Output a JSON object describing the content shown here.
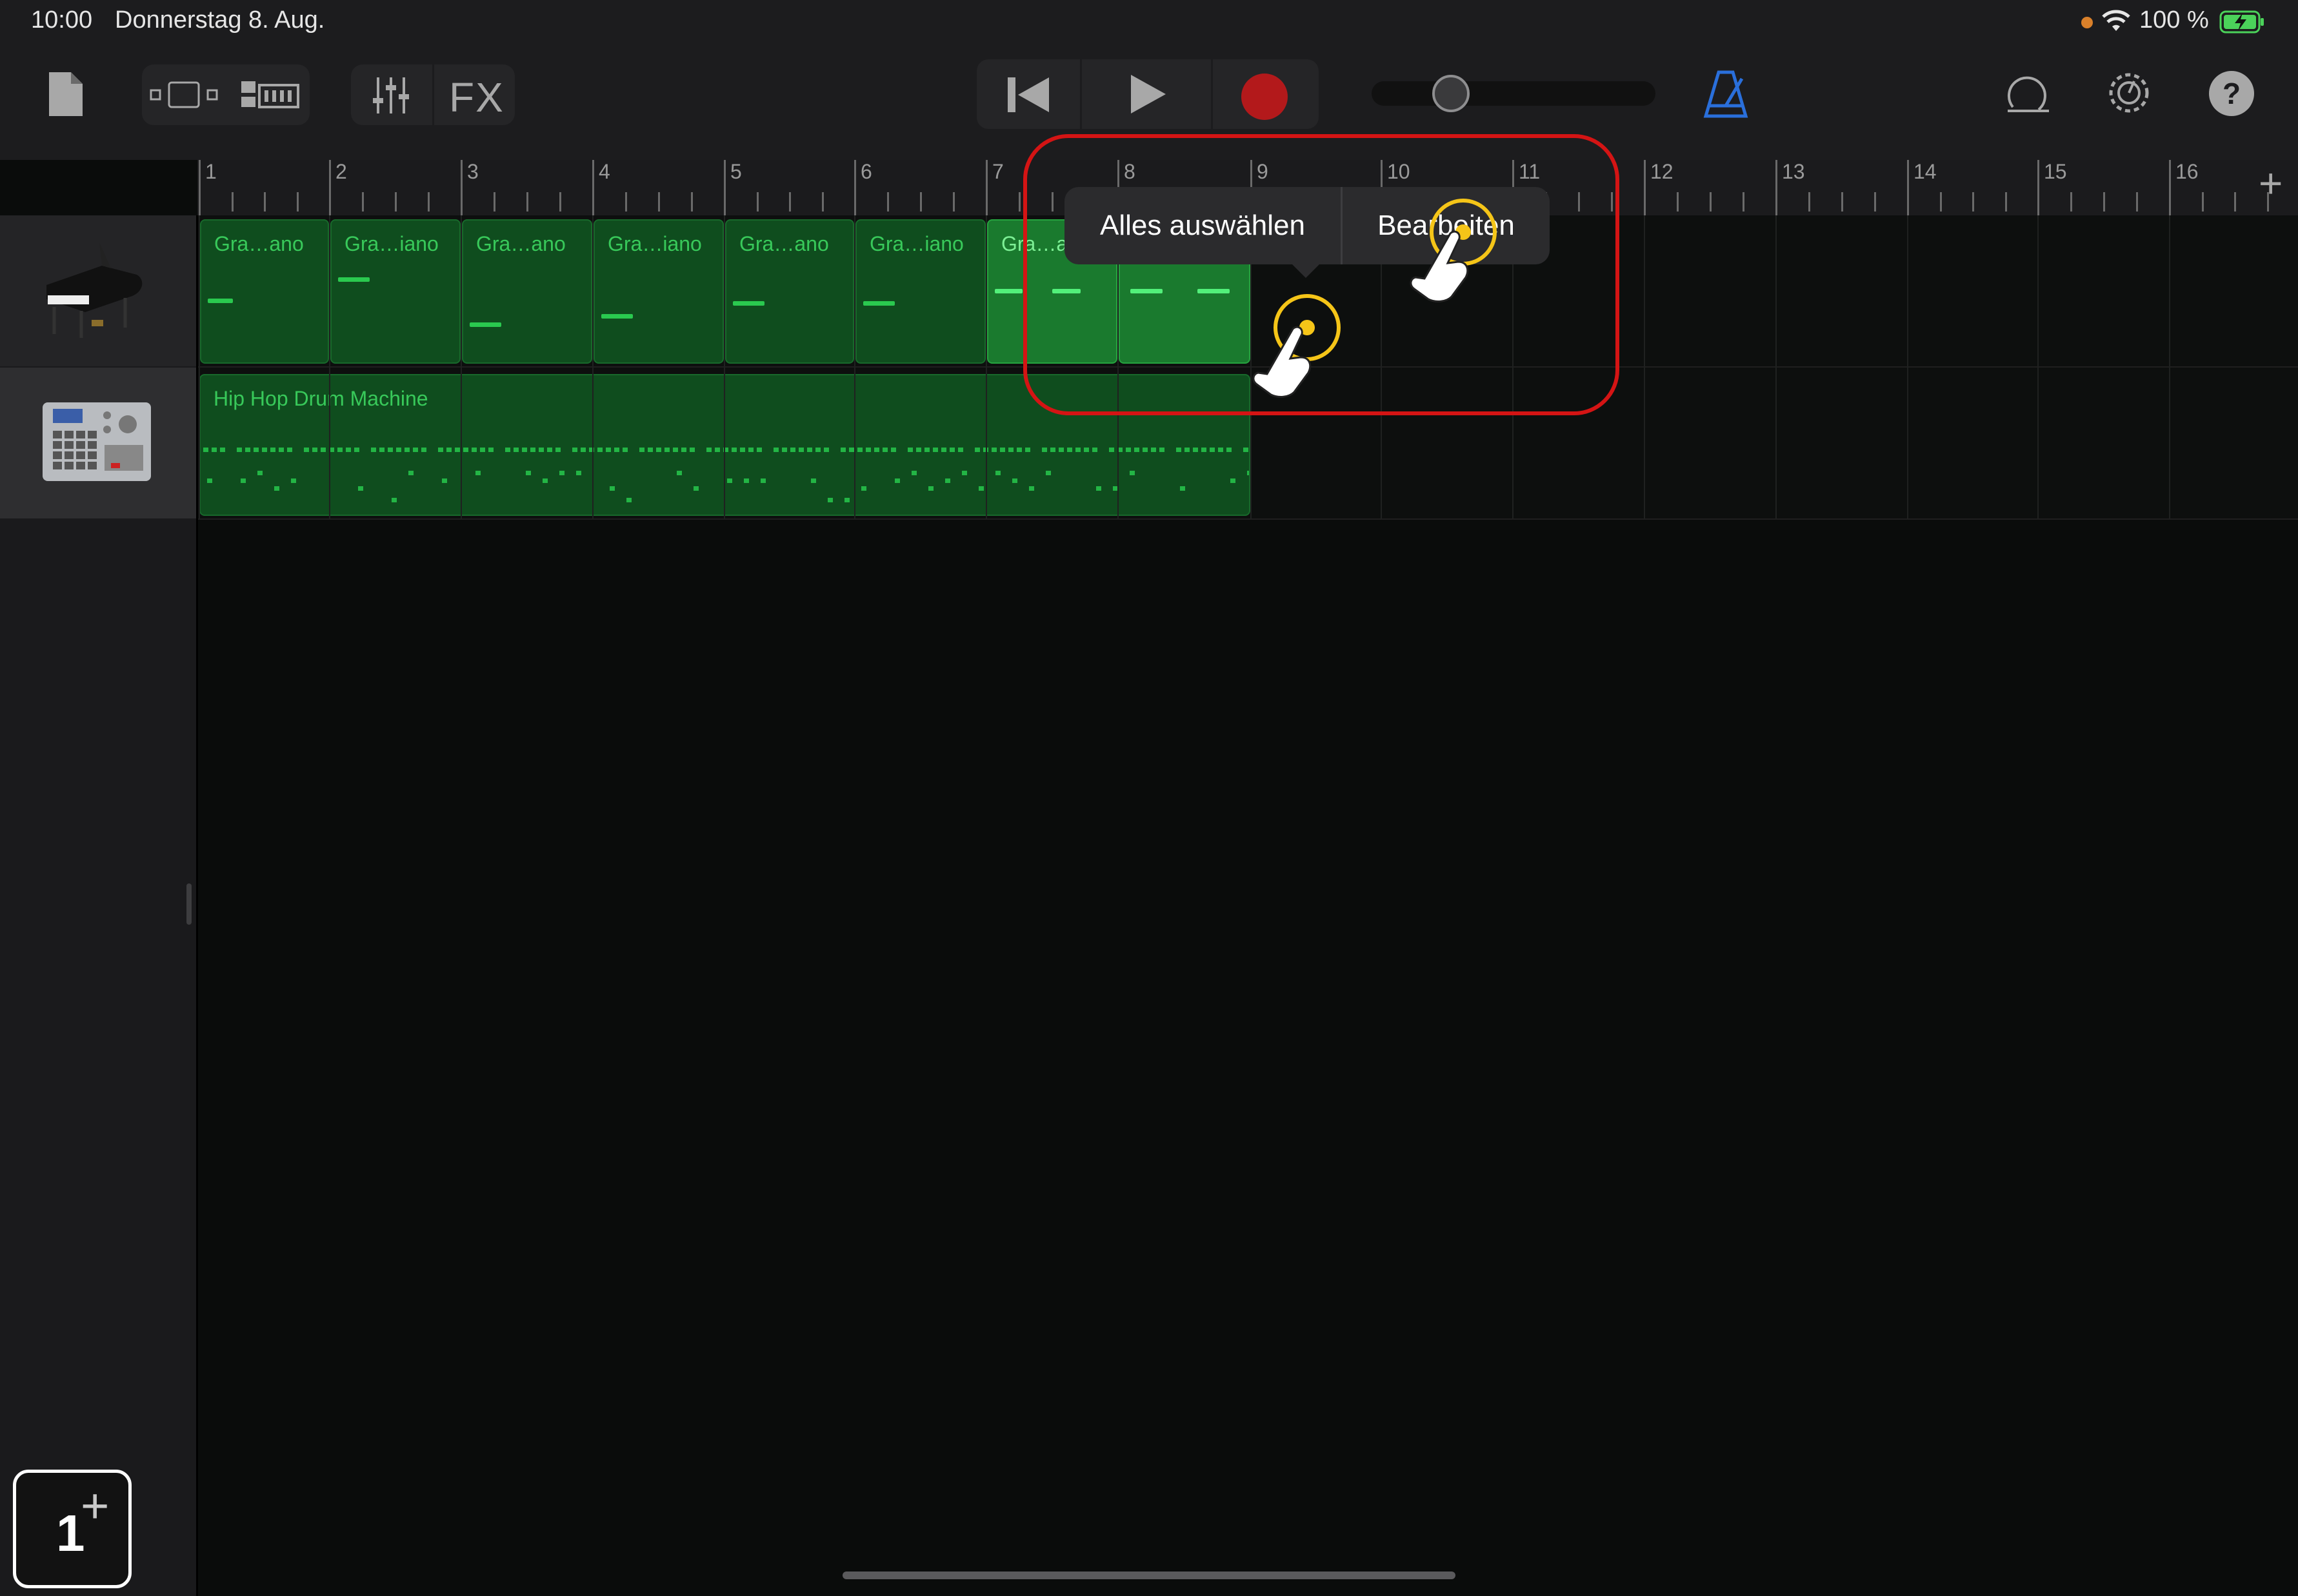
{
  "status_bar": {
    "time": "10:00",
    "date": "Donnerstag 8. Aug.",
    "battery": "100 %"
  },
  "toolbar": {
    "fx_label": "FX",
    "accent_color": "#2a6fdb",
    "record_color": "#b3191b",
    "icons": [
      "document-icon",
      "track-view-icon",
      "smart-controls-icon",
      "mixer-icon",
      "rewind-icon",
      "play-icon",
      "record-icon",
      "volume-slider",
      "metronome-icon",
      "loop-icon",
      "settings-icon",
      "help-icon"
    ]
  },
  "ruler": {
    "bars": [
      "1",
      "2",
      "3",
      "4",
      "5",
      "6",
      "7",
      "8",
      "9",
      "10",
      "11",
      "12",
      "13",
      "14",
      "15",
      "16"
    ],
    "add_section_label": "+"
  },
  "tracks": [
    {
      "name": "Grand Piano",
      "icon": "grand-piano-icon",
      "regions": [
        {
          "label": "Gra…ano",
          "selected": false
        },
        {
          "label": "Gra…iano",
          "selected": false
        },
        {
          "label": "Gra…ano",
          "selected": false
        },
        {
          "label": "Gra…iano",
          "selected": false
        },
        {
          "label": "Gra…ano",
          "selected": false
        },
        {
          "label": "Gra…iano",
          "selected": false
        },
        {
          "label": "Gra…ano",
          "selected": true
        },
        {
          "label": "",
          "selected": true
        }
      ]
    },
    {
      "name": "Hip Hop Drum Machine",
      "icon": "drum-machine-icon",
      "regions": [
        {
          "label": "Hip Hop Drum Machine",
          "selected": false
        }
      ]
    }
  ],
  "popup_menu": {
    "items": [
      "Alles auswählen",
      "Bearbeiten"
    ]
  },
  "add_track": {
    "count": "1",
    "plus": "+"
  }
}
